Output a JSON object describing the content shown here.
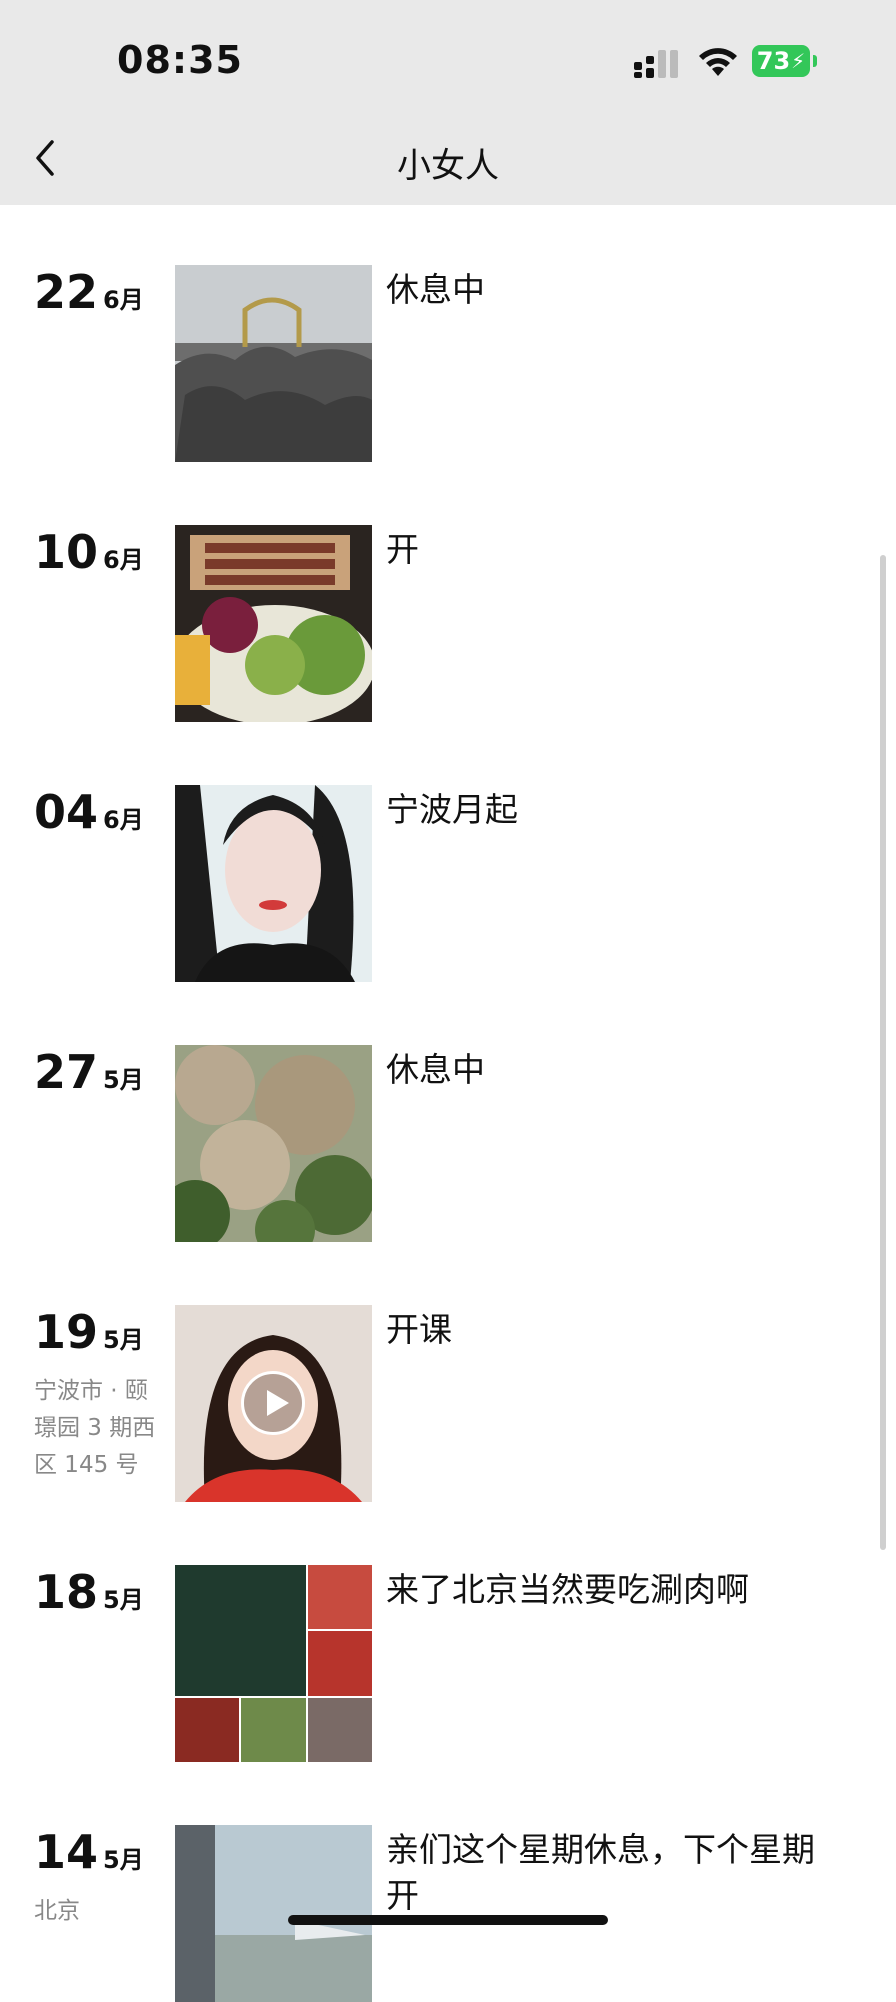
{
  "status": {
    "time": "08:35",
    "battery": "73"
  },
  "nav": {
    "title": "小女人"
  },
  "entries": [
    {
      "day": "22",
      "month": "6月",
      "location": "",
      "caption": "休息中",
      "media": "image"
    },
    {
      "day": "10",
      "month": "6月",
      "location": "",
      "caption": "开",
      "media": "image"
    },
    {
      "day": "04",
      "month": "6月",
      "location": "",
      "caption": "宁波月起",
      "media": "image"
    },
    {
      "day": "27",
      "month": "5月",
      "location": "",
      "caption": "休息中",
      "media": "image"
    },
    {
      "day": "19",
      "month": "5月",
      "location": "宁波市 · 颐璟园 3 期西区 145 号",
      "caption": "开课",
      "media": "video"
    },
    {
      "day": "18",
      "month": "5月",
      "location": "",
      "caption": "来了北京当然要吃涮肉啊",
      "media": "image-grid"
    },
    {
      "day": "14",
      "month": "5月",
      "location": "北京",
      "caption": "亲们这个星期休息，下个星期开",
      "media": "image"
    }
  ],
  "colors": {
    "status_bg": "#e9e9e9",
    "battery": "#33c759",
    "location_text": "#888888"
  }
}
